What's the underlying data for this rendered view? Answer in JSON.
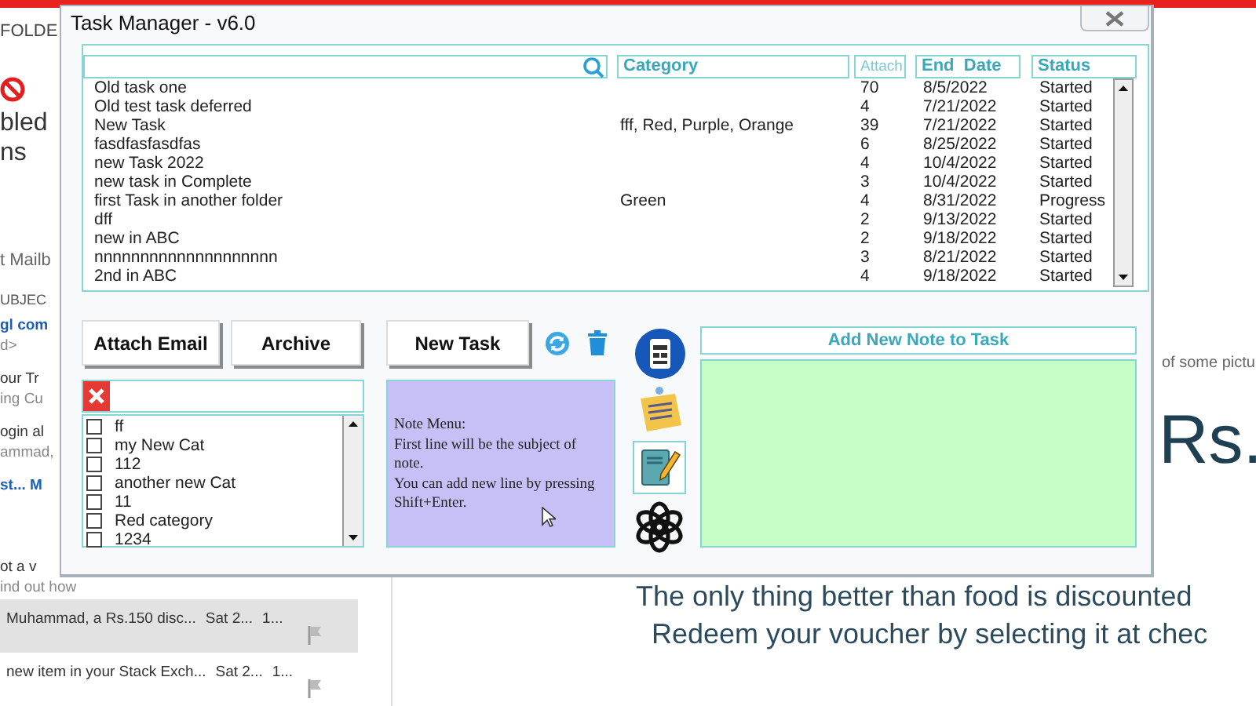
{
  "ribbon": {
    "tab": "FOLDE",
    "button_lines": [
      "bled",
      "ns"
    ]
  },
  "folder_pane": {
    "label": "t Mailb"
  },
  "mail_list": {
    "column": "UBJEC",
    "items": [
      {
        "lines": [
          "gl com",
          "d>"
        ],
        "unread": true
      },
      {
        "lines": [
          "our Tr",
          "ing Cu"
        ],
        "unread": false
      },
      {
        "lines": [
          "ogin al",
          "ammad,"
        ],
        "unread": false
      },
      {
        "lines": [
          "st... M"
        ],
        "unread": true
      },
      {
        "lines": [
          "ot a v",
          "ind out how"
        ],
        "unread": false
      }
    ],
    "messages": [
      {
        "subject": "Muhammad, a Rs.150 disc...",
        "date": "Sat 2...",
        "size": "1...",
        "selected": true
      },
      {
        "subject": "new item in your Stack Exch...",
        "date": "Sat 2...",
        "size": "1...",
        "selected": false
      }
    ]
  },
  "reading_pane": {
    "caption": "of some pictu",
    "amount": "Rs.",
    "lines": [
      "The only thing better than food is discounted",
      "Redeem your voucher by selecting it at chec"
    ]
  },
  "window": {
    "title": "Task Manager - v6.0"
  },
  "task_table": {
    "columns": [
      "Category",
      "Attach",
      "End  Date",
      "Status"
    ],
    "rows": [
      {
        "task": "Old task one",
        "category": "",
        "attach": "70",
        "end_date": "8/5/2022",
        "status": "Started"
      },
      {
        "task": "Old test task deferred",
        "category": "",
        "attach": "4",
        "end_date": "7/21/2022",
        "status": "Started"
      },
      {
        "task": "New Task",
        "category": "fff, Red, Purple, Orange",
        "attach": "39",
        "end_date": "7/21/2022",
        "status": "Started"
      },
      {
        "task": "fasdfasfasdfas",
        "category": "",
        "attach": "6",
        "end_date": "8/25/2022",
        "status": "Started"
      },
      {
        "task": "new Task 2022",
        "category": "",
        "attach": "4",
        "end_date": "10/4/2022",
        "status": "Started"
      },
      {
        "task": "new task in Complete",
        "category": "",
        "attach": "3",
        "end_date": "10/4/2022",
        "status": "Started"
      },
      {
        "task": "first Task in another folder",
        "category": "Green",
        "attach": "4",
        "end_date": "8/31/2022",
        "status": "Progress"
      },
      {
        "task": "dff",
        "category": "",
        "attach": "2",
        "end_date": "9/13/2022",
        "status": "Started"
      },
      {
        "task": "new in ABC",
        "category": "",
        "attach": "2",
        "end_date": "9/18/2022",
        "status": "Started"
      },
      {
        "task": "nnnnnnnnnnnnnnnnnnnn",
        "category": "",
        "attach": "3",
        "end_date": "8/21/2022",
        "status": "Started"
      },
      {
        "task": "2nd in ABC",
        "category": "",
        "attach": "4",
        "end_date": "9/18/2022",
        "status": "Started"
      }
    ]
  },
  "buttons": [
    "Attach Email",
    "Archive",
    "New Task"
  ],
  "categories": [
    {
      "label": "ff",
      "checked": false
    },
    {
      "label": "my New Cat",
      "checked": false
    },
    {
      "label": "112",
      "checked": false
    },
    {
      "label": "another new Cat",
      "checked": false
    },
    {
      "label": "11",
      "checked": false
    },
    {
      "label": "Red category",
      "checked": false
    },
    {
      "label": "1234",
      "checked": false
    }
  ],
  "note_menu": {
    "lines": [
      "Note Menu:",
      "First line will be the subject of note.",
      "You can add new line by pressing Shift+Enter."
    ]
  },
  "note_panel": {
    "title": "Add New Note to Task"
  }
}
